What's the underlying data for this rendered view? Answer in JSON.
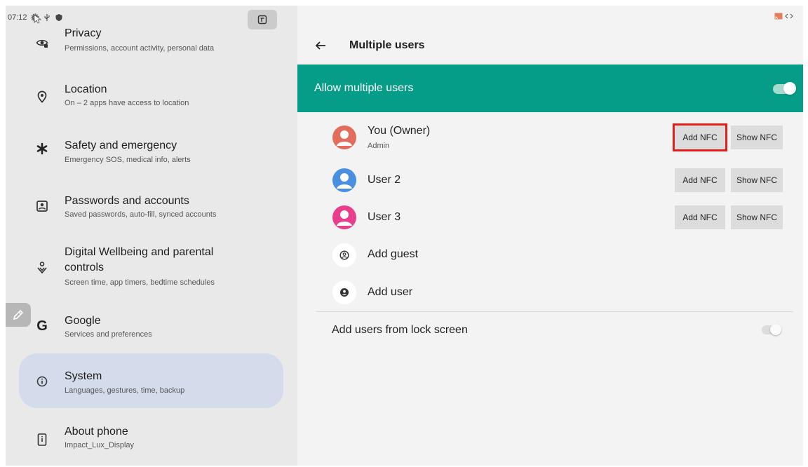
{
  "status_bar": {
    "time": "07:12"
  },
  "settings_list": [
    {
      "key": "privacy",
      "title": "Privacy",
      "subtitle": "Permissions, account activity, personal data",
      "icon": "privacy-eye-icon"
    },
    {
      "key": "location",
      "title": "Location",
      "subtitle": "On – 2 apps have access to location",
      "icon": "location-pin-icon"
    },
    {
      "key": "safety",
      "title": "Safety and emergency",
      "subtitle": "Emergency SOS, medical info, alerts",
      "icon": "asterisk-icon"
    },
    {
      "key": "passwords",
      "title": "Passwords and accounts",
      "subtitle": "Saved passwords, auto-fill, synced accounts",
      "icon": "account-box-icon"
    },
    {
      "key": "wellbeing",
      "title_line1": "Digital Wellbeing and parental",
      "title_line2": "controls",
      "subtitle": "Screen time, app timers, bedtime schedules",
      "icon": "wellbeing-icon"
    },
    {
      "key": "google",
      "title": "Google",
      "subtitle": "Services and preferences",
      "icon": "google-g-icon"
    },
    {
      "key": "system",
      "title": "System",
      "subtitle": "Languages, gestures, time, backup",
      "icon": "info-icon",
      "selected": true
    },
    {
      "key": "about",
      "title": "About phone",
      "subtitle": "Impact_Lux_Display",
      "icon": "phone-icon"
    }
  ],
  "detail": {
    "title": "Multiple users",
    "allow_label": "Allow multiple users",
    "allow_enabled": true,
    "users": [
      {
        "name": "You (Owner)",
        "subtitle": "Admin",
        "avatar_color": "#e26d5c",
        "add_label": "Add NFC",
        "show_label": "Show NFC"
      },
      {
        "name": "User 2",
        "avatar_color": "#4a90e2",
        "add_label": "Add NFC",
        "show_label": "Show NFC"
      },
      {
        "name": "User 3",
        "avatar_color": "#e83e8c",
        "add_label": "Add NFC",
        "show_label": "Show NFC"
      }
    ],
    "add_guest": "Add guest",
    "add_user": "Add user",
    "lock_screen_label": "Add users from lock screen",
    "lock_screen_enabled": false
  },
  "colors": {
    "accent": "#059d87",
    "selected_bg": "#d4dbeb",
    "highlight": "#e0201b"
  }
}
